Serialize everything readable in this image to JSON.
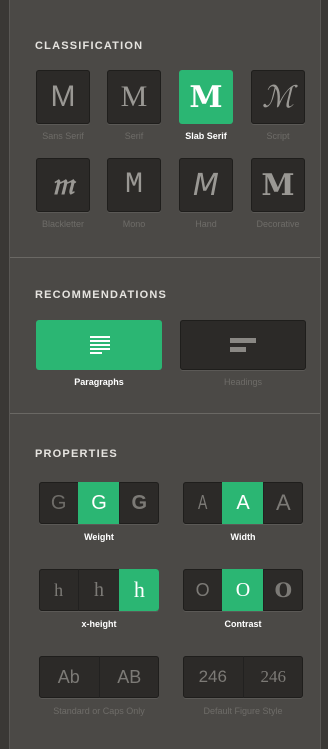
{
  "colors": {
    "accent": "#2bb673",
    "panel": "#4b4946",
    "tile": "#2c2a28"
  },
  "classification": {
    "title": "CLASSIFICATION",
    "items": [
      {
        "glyph": "M",
        "label": "Sans Serif",
        "active": false
      },
      {
        "glyph": "M",
        "label": "Serif",
        "active": false
      },
      {
        "glyph": "M",
        "label": "Slab Serif",
        "active": true
      },
      {
        "glyph": "ℳ",
        "label": "Script",
        "active": false
      },
      {
        "glyph": "𝔪",
        "label": "Blackletter",
        "active": false
      },
      {
        "glyph": "M",
        "label": "Mono",
        "active": false
      },
      {
        "glyph": "M",
        "label": "Hand",
        "active": false
      },
      {
        "glyph": "M",
        "label": "Decorative",
        "active": false
      }
    ]
  },
  "recommendations": {
    "title": "RECOMMENDATIONS",
    "items": [
      {
        "label": "Paragraphs",
        "icon": "paragraph-lines-icon",
        "active": true
      },
      {
        "label": "Headings",
        "icon": "heading-lines-icon",
        "active": false
      }
    ]
  },
  "properties": {
    "title": "PROPERTIES",
    "weight": {
      "label": "Weight",
      "cells": [
        "G",
        "G",
        "G"
      ],
      "active": 1
    },
    "width": {
      "label": "Width",
      "cells": [
        "A",
        "A",
        "A"
      ],
      "active": 1
    },
    "xheight": {
      "label": "x-height",
      "cells": [
        "h",
        "h",
        "h"
      ],
      "active": 2
    },
    "contrast": {
      "label": "Contrast",
      "cells": [
        "O",
        "O",
        "O"
      ],
      "active": 1
    },
    "caps": {
      "label": "Standard or Caps Only",
      "cells": [
        "Ab",
        "AB"
      ],
      "active": -1
    },
    "figures": {
      "label": "Default Figure Style",
      "cells": [
        "246",
        "246"
      ],
      "active": -1
    }
  }
}
